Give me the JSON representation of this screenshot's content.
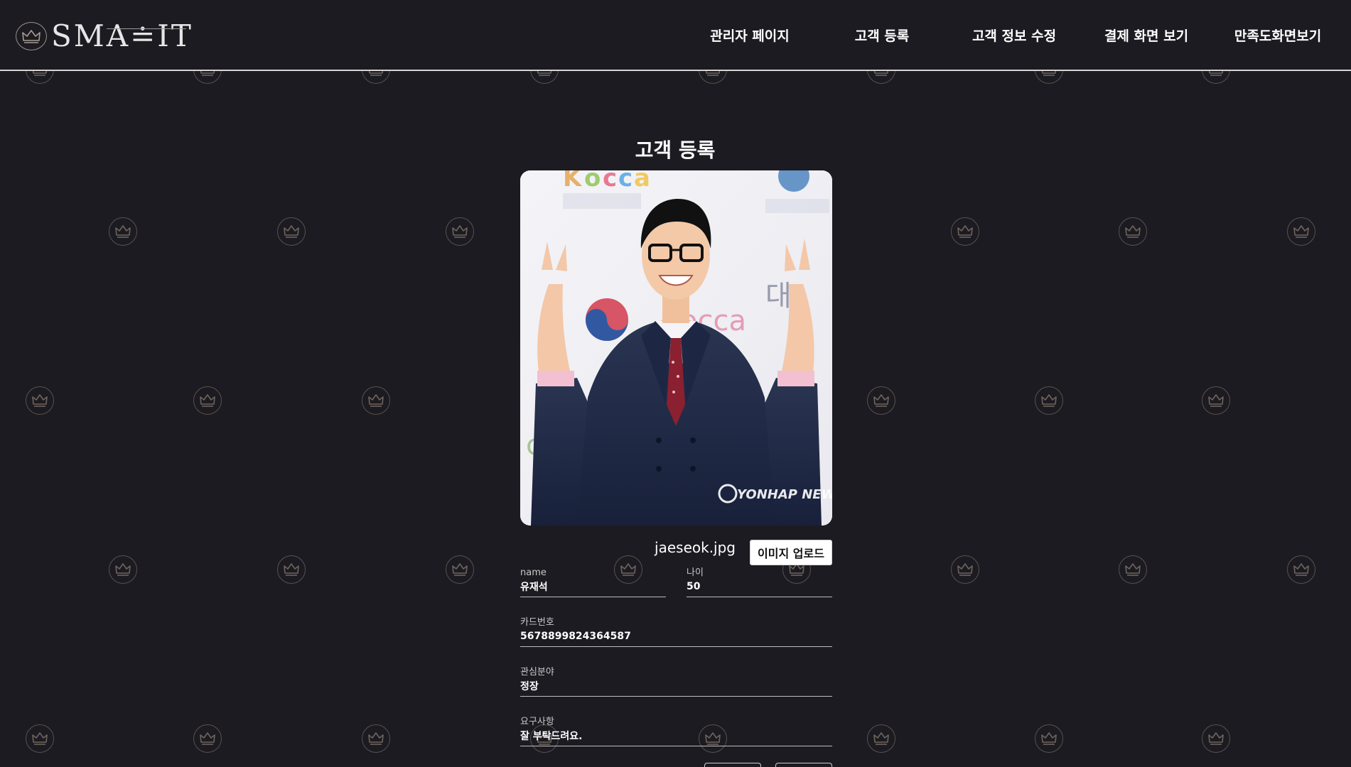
{
  "header": {
    "logo_text": "SMA≐IT",
    "nav": [
      {
        "label": "관리자 페이지"
      },
      {
        "label": "고객 등록"
      },
      {
        "label": "고객 정보 수정"
      },
      {
        "label": "결제 화면 보기"
      },
      {
        "label": "만족도화면보기"
      }
    ]
  },
  "form": {
    "title": "고객 등록",
    "photo": {
      "alt": "uploaded customer photo",
      "watermark": "YONHAP NEWS"
    },
    "file_name": "jaeseok.jpg",
    "upload_button": "이미지 업로드",
    "fields": {
      "name": {
        "label": "name",
        "value": "유재석"
      },
      "age": {
        "label": "나이",
        "value": "50"
      },
      "card": {
        "label": "카드번호",
        "value": "5678899824364587"
      },
      "interest": {
        "label": "관심분야",
        "value": "정장"
      },
      "request": {
        "label": "요구사항",
        "value": "잘 부탁드려요."
      }
    }
  },
  "colors": {
    "background": "#1c1b22",
    "text": "#ffffff",
    "watermark": "#8a7d6e"
  },
  "icons": {
    "logo": "crown-icon",
    "watermark": "crown-icon"
  }
}
